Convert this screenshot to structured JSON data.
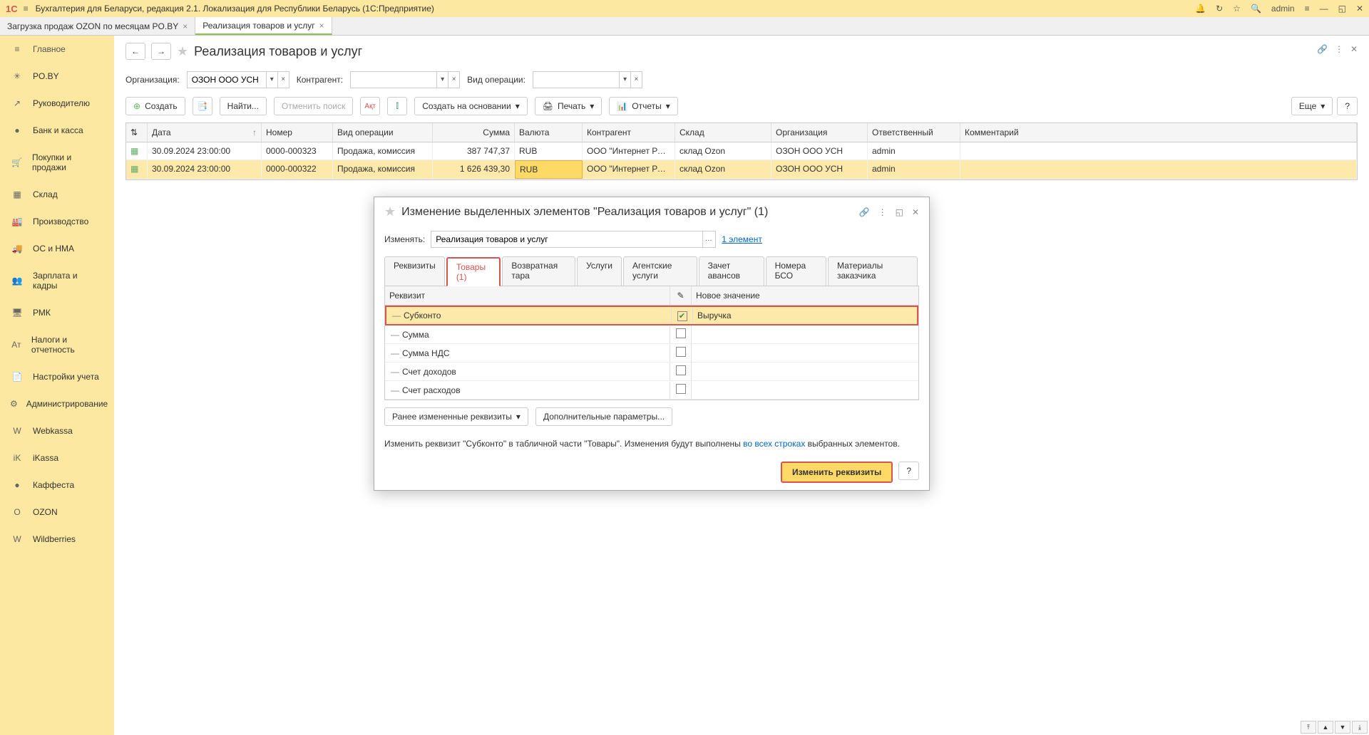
{
  "titlebar": {
    "logo": "1С",
    "title": "Бухгалтерия для Беларуси, редакция 2.1. Локализация для Республики Беларусь  (1С:Предприятие)",
    "user": "admin"
  },
  "tabs": [
    {
      "label": "Загрузка продаж OZON по месяцам PO.BY",
      "active": false
    },
    {
      "label": "Реализация товаров и услуг",
      "active": true
    }
  ],
  "sidebar": [
    {
      "label": "Главное",
      "icon": "≡"
    },
    {
      "label": "PO.BY",
      "icon": "✳"
    },
    {
      "label": "Руководителю",
      "icon": "↗"
    },
    {
      "label": "Банк и касса",
      "icon": "●"
    },
    {
      "label": "Покупки и продажи",
      "icon": "🛒"
    },
    {
      "label": "Склад",
      "icon": "▦"
    },
    {
      "label": "Производство",
      "icon": "🏭"
    },
    {
      "label": "ОС и НМА",
      "icon": "🚚"
    },
    {
      "label": "Зарплата и кадры",
      "icon": "👥"
    },
    {
      "label": "РМК",
      "icon": "🖥"
    },
    {
      "label": "Налоги и отчетность",
      "icon": "Ат"
    },
    {
      "label": "Настройки учета",
      "icon": "📄"
    },
    {
      "label": "Администрирование",
      "icon": "⚙"
    },
    {
      "label": "Webkassa",
      "icon": "W"
    },
    {
      "label": "iKassa",
      "icon": "iK"
    },
    {
      "label": "Каффеста",
      "icon": "●"
    },
    {
      "label": "OZON",
      "icon": "O"
    },
    {
      "label": "Wildberries",
      "icon": "W"
    }
  ],
  "page": {
    "title": "Реализация товаров и услуг",
    "filters": {
      "org_label": "Организация:",
      "org_value": "ОЗОН ООО УСН",
      "kontr_label": "Контрагент:",
      "kontr_value": "",
      "op_label": "Вид операции:",
      "op_value": ""
    },
    "toolbar": {
      "create": "Создать",
      "search": "Найти...",
      "cancel_search": "Отменить поиск",
      "create_based": "Создать на основании",
      "print": "Печать",
      "reports": "Отчеты",
      "more": "Еще",
      "help": "?"
    },
    "columns": [
      "",
      "Дата",
      "Номер",
      "Вид операции",
      "Сумма",
      "Валюта",
      "Контрагент",
      "Склад",
      "Организация",
      "Ответственный",
      "Комментарий"
    ],
    "rows": [
      {
        "date": "30.09.2024 23:00:00",
        "num": "0000-000323",
        "op": "Продажа, комиссия",
        "sum": "387 747,37",
        "curr": "RUB",
        "kontr": "ООО \"Интернет Решен...",
        "skl": "склад Ozon",
        "org": "ОЗОН ООО УСН",
        "resp": "admin",
        "comm": "",
        "selected": false
      },
      {
        "date": "30.09.2024 23:00:00",
        "num": "0000-000322",
        "op": "Продажа, комиссия",
        "sum": "1 626 439,30",
        "curr": "RUB",
        "kontr": "ООО \"Интернет Решен...",
        "skl": "склад Ozon",
        "org": "ОЗОН ООО УСН",
        "resp": "admin",
        "comm": "",
        "selected": true
      }
    ]
  },
  "dialog": {
    "title": "Изменение выделенных элементов \"Реализация товаров и услуг\" (1)",
    "change_label": "Изменять:",
    "change_value": "Реализация товаров и услуг",
    "elements_link": "1 элемент",
    "tabs": [
      "Реквизиты",
      "Товары (1)",
      "Возвратная тара",
      "Услуги",
      "Агентские услуги",
      "Зачет авансов",
      "Номера БСО",
      "Материалы заказчика"
    ],
    "active_tab": 1,
    "req_head": [
      "Реквизит",
      "✎",
      "Новое значение"
    ],
    "req_rows": [
      {
        "name": "Субконто",
        "checked": true,
        "value": "Выручка",
        "selected": true
      },
      {
        "name": "Сумма",
        "checked": false,
        "value": ""
      },
      {
        "name": "Сумма НДС",
        "checked": false,
        "value": ""
      },
      {
        "name": "Счет доходов",
        "checked": false,
        "value": ""
      },
      {
        "name": "Счет расходов",
        "checked": false,
        "value": ""
      }
    ],
    "prev_changes_btn": "Ранее измененные реквизиты",
    "extra_params_btn": "Дополнительные параметры...",
    "info_pre": "Изменить реквизит \"Субконто\" в табличной части \"Товары\". Изменения будут выполнены ",
    "info_link": "во всех строках",
    "info_post": " выбранных элементов.",
    "apply_btn": "Изменить реквизиты",
    "help_btn": "?"
  }
}
